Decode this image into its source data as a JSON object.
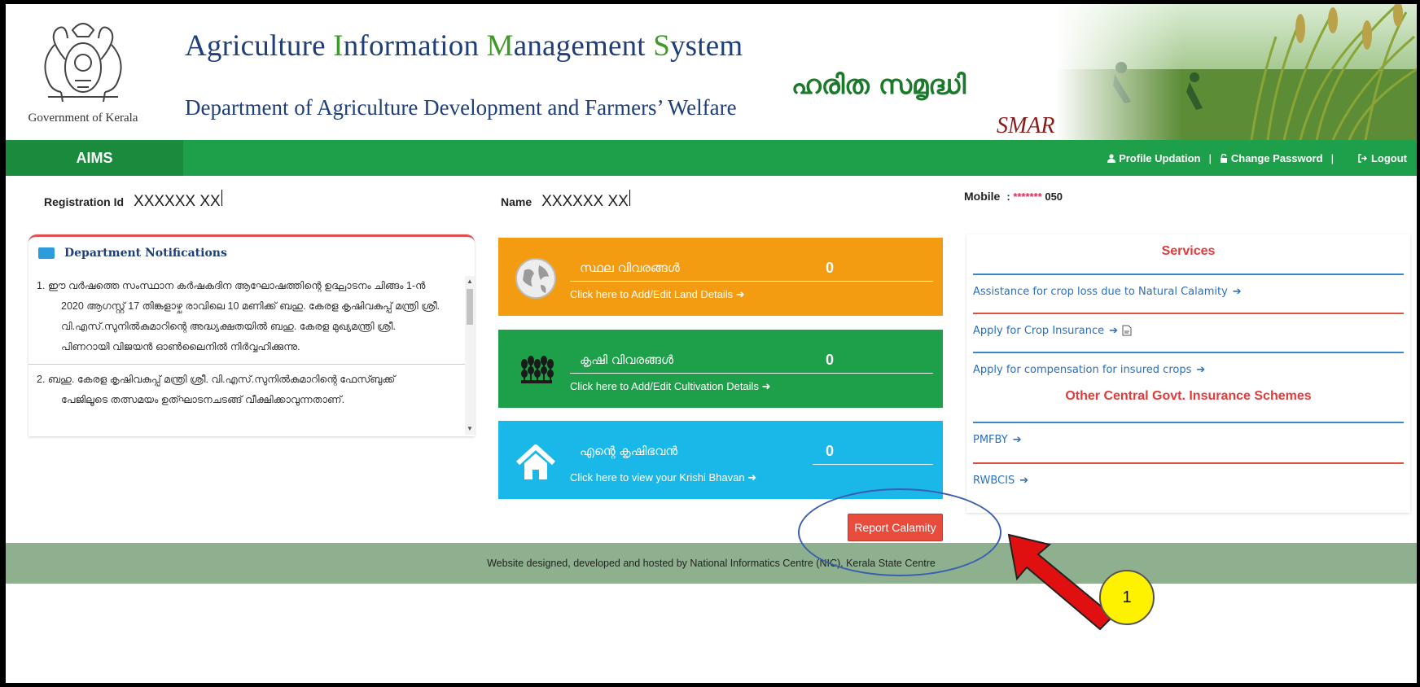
{
  "header": {
    "gov_caption": "Government of Kerala",
    "app_title_parts": [
      "Agriculture ",
      "I",
      "nformation ",
      "M",
      "anagement ",
      "S",
      "ystem"
    ],
    "dept_title": "Department of Agriculture Development and Farmers’ Welfare",
    "brand_malayalam": "ഹരിത സമൃദ്ധി",
    "brand_smart": "SMART"
  },
  "nav": {
    "brand": "AIMS",
    "profile": "Profile Updation",
    "sep1": "|",
    "change_password": "Change Password",
    "sep2": "|",
    "logout": "Logout"
  },
  "user": {
    "registration_label": "Registration Id",
    "registration_value": "XXXXXX XX",
    "name_label": "Name",
    "name_value": "XXXXXX XX",
    "mobile_label": "Mobile",
    "mobile_sep": ":",
    "mobile_mask": "*******",
    "mobile_tail": " 050"
  },
  "notifications": {
    "title": "Department Notifications",
    "items": [
      {
        "lines": [
          "1. ഈ വർഷത്തെ സംസ്ഥാന കർഷകദിന ആഘോഷത്തിന്റെ ഉദ്ഘാടനം ചിങ്ങം 1-ൻ",
          "2020 ആഗസ്റ്റ് 17 തിങ്കളാഴ്ച രാവിലെ 10 മണിക്ക് ബഹു. കേരള കൃഷിവകുപ്പ് മന്ത്രി ശ്രീ.",
          "വി.എസ്.സുനിൽകുമാറിന്റെ അദ്ധ്യക്ഷതയിൽ ബഹു. കേരള മുഖ്യമന്ത്രി ശ്രീ.",
          "പിണറായി വിജയൻ ഓൺലൈനിൽ നിർവ്വഹിക്കുന്നു."
        ]
      },
      {
        "lines": [
          "2. ബഹു. കേരള കൃഷിവകുപ്പ് മന്ത്രി ശ്രീ. വി.എസ്.സുനിൽകുമാറിന്റെ ഫേസ്ബുക്ക്",
          "പേജിലൂടെ തത്സമയം ഉത്ഘാടനചടങ്ങ് വീക്ഷിക്കാവുന്നതാണ്."
        ]
      }
    ]
  },
  "cards": {
    "land": {
      "title": "സ്ഥല വിവരങ്ങൾ",
      "count": "0",
      "link": "Click here to Add/Edit Land Details",
      "color": "#f39c12"
    },
    "cultivation": {
      "title": "കൃഷി വിവരങ്ങൾ",
      "count": "0",
      "link": "Click here to Add/Edit Cultivation Details",
      "color": "#1e9f49"
    },
    "krishibhavan": {
      "title": "എന്റെ കൃഷിഭവൻ",
      "count": "0",
      "link": "Click here to view your Krishi Bhavan",
      "color": "#1ab8e8"
    }
  },
  "report_button": "Report Calamity",
  "services": {
    "title": "Services",
    "items": [
      "Assistance for crop loss due to Natural Calamity",
      "Apply for Crop Insurance",
      "Apply for compensation for insured crops"
    ],
    "other_title": "Other Central Govt. Insurance Schemes",
    "other_items": [
      "PMFBY",
      "RWBCIS"
    ]
  },
  "footer": "Website designed, developed and hosted by National Informatics Centre (NIC), Kerala State Centre",
  "annotation": {
    "marker": "1",
    "marker_color": "#fff200",
    "arrow_color": "#e01010"
  },
  "colors": {
    "nav_green": "#1e9f49",
    "title_blue": "#1f3f7a",
    "link_blue": "#2a6fc1",
    "red": "#e23b3b"
  },
  "icons": [
    "emblem-icon",
    "user-icon",
    "lock-icon",
    "logout-icon",
    "notification-icon",
    "globe-icon",
    "crop-icon",
    "home-icon",
    "arrow-right-icon",
    "pdf-icon",
    "circle-arrow-icon"
  ]
}
